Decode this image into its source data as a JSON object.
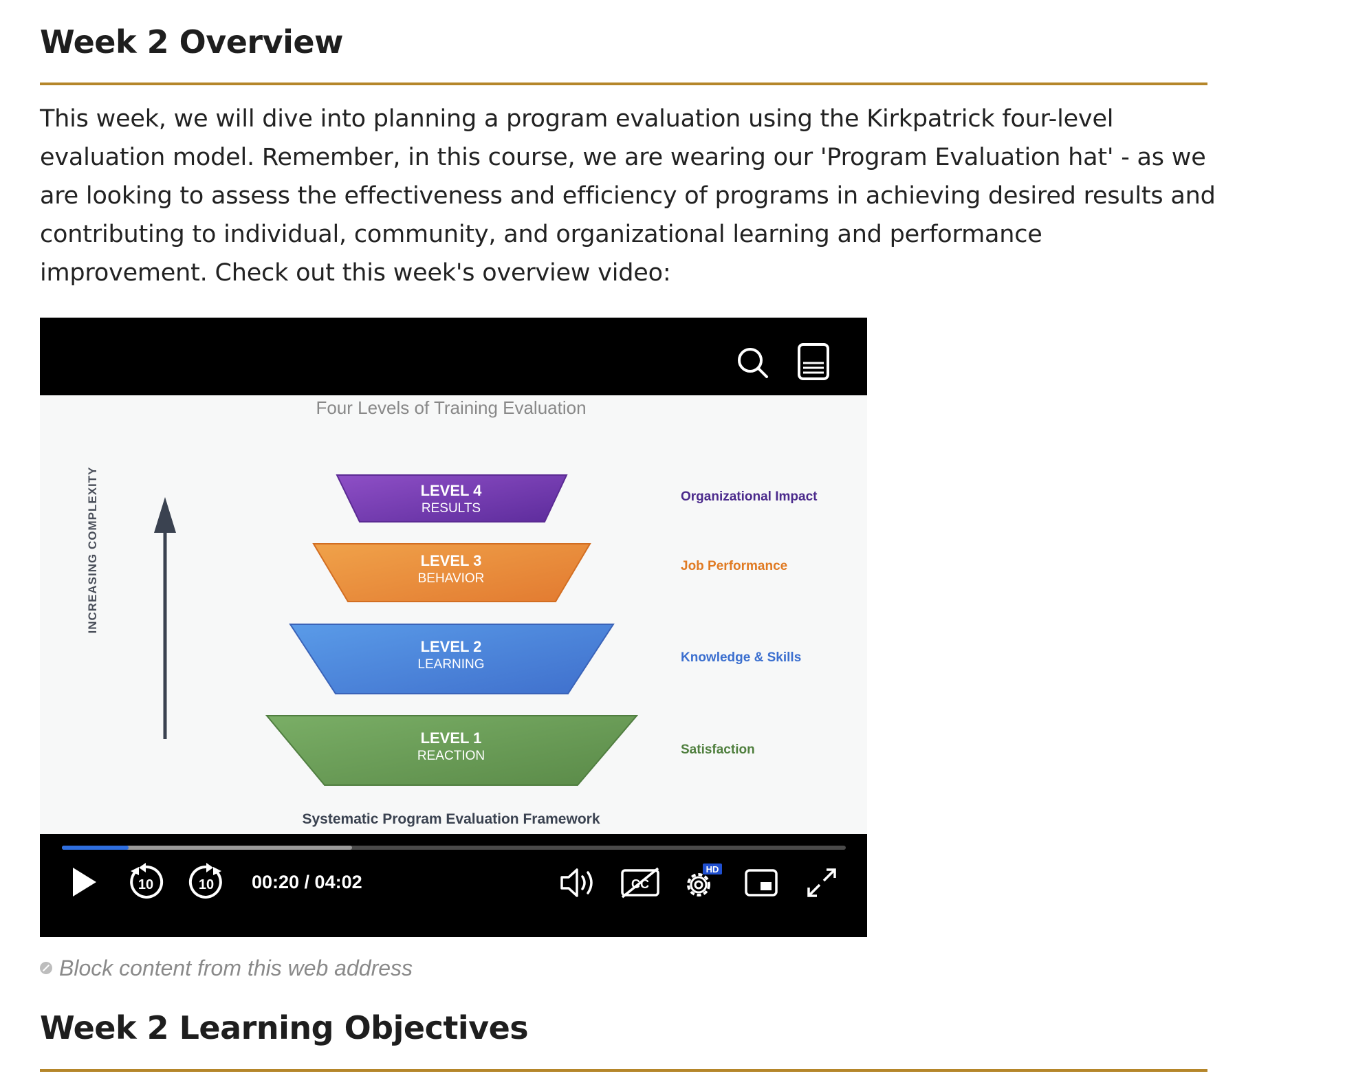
{
  "page": {
    "overview_heading": "Week 2 Overview",
    "intro_text": "This week, we will dive into planning a program evaluation using the Kirkpatrick four-level evaluation model. Remember, in this course, we are wearing our 'Program Evaluation hat' - as we are looking to assess the effectiveness and efficiency of programs in achieving desired results and contributing to individual, community, and organizational learning and performance improvement. Check out this week's overview video:",
    "block_notice": "Block content from this web address",
    "objectives_heading": "Week 2 Learning Objectives",
    "accent_color": "#b5862a"
  },
  "player": {
    "top_icons": [
      "search-icon",
      "transcript-icon"
    ],
    "time_display": "00:20 / 04:02",
    "progress": {
      "played_fraction": 0.085,
      "buffered_fraction": 0.37
    },
    "quality_badge": "HD",
    "control_icons": [
      "play-icon",
      "rewind-10-icon",
      "forward-10-icon",
      "volume-icon",
      "captions-off-icon",
      "settings-icon",
      "picture-in-picture-icon",
      "fullscreen-icon"
    ],
    "skip_label": "10"
  },
  "slide": {
    "title": "Four Levels of Training Evaluation",
    "axis_label": "INCREASING COMPLEXITY",
    "footer": "Systematic Program Evaluation Framework",
    "levels": [
      {
        "level": "LEVEL 4",
        "name": "RESULTS",
        "description": "Organizational Impact",
        "color": "#7b3fb3",
        "text_color": "#4b2a8c"
      },
      {
        "level": "LEVEL 3",
        "name": "BEHAVIOR",
        "description": "Job Performance",
        "color": "#e88a3a",
        "text_color": "#e07a22"
      },
      {
        "level": "LEVEL 2",
        "name": "LEARNING",
        "description": "Knowledge & Skills",
        "color": "#4a86dd",
        "text_color": "#3b6fcf"
      },
      {
        "level": "LEVEL 1",
        "name": "REACTION",
        "description": "Satisfaction",
        "color": "#6e9e5a",
        "text_color": "#4f7f3e"
      }
    ]
  }
}
